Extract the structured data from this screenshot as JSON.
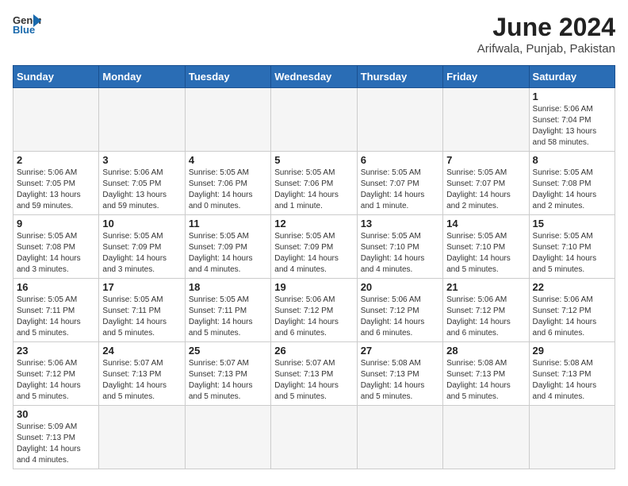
{
  "header": {
    "logo_general": "General",
    "logo_blue": "Blue",
    "month_year": "June 2024",
    "location": "Arifwala, Punjab, Pakistan"
  },
  "weekdays": [
    "Sunday",
    "Monday",
    "Tuesday",
    "Wednesday",
    "Thursday",
    "Friday",
    "Saturday"
  ],
  "days": [
    {
      "num": "",
      "info": ""
    },
    {
      "num": "",
      "info": ""
    },
    {
      "num": "",
      "info": ""
    },
    {
      "num": "",
      "info": ""
    },
    {
      "num": "",
      "info": ""
    },
    {
      "num": "",
      "info": ""
    },
    {
      "num": "1",
      "info": "Sunrise: 5:06 AM\nSunset: 7:04 PM\nDaylight: 13 hours\nand 58 minutes."
    },
    {
      "num": "2",
      "info": "Sunrise: 5:06 AM\nSunset: 7:05 PM\nDaylight: 13 hours\nand 59 minutes."
    },
    {
      "num": "3",
      "info": "Sunrise: 5:06 AM\nSunset: 7:05 PM\nDaylight: 13 hours\nand 59 minutes."
    },
    {
      "num": "4",
      "info": "Sunrise: 5:05 AM\nSunset: 7:06 PM\nDaylight: 14 hours\nand 0 minutes."
    },
    {
      "num": "5",
      "info": "Sunrise: 5:05 AM\nSunset: 7:06 PM\nDaylight: 14 hours\nand 1 minute."
    },
    {
      "num": "6",
      "info": "Sunrise: 5:05 AM\nSunset: 7:07 PM\nDaylight: 14 hours\nand 1 minute."
    },
    {
      "num": "7",
      "info": "Sunrise: 5:05 AM\nSunset: 7:07 PM\nDaylight: 14 hours\nand 2 minutes."
    },
    {
      "num": "8",
      "info": "Sunrise: 5:05 AM\nSunset: 7:08 PM\nDaylight: 14 hours\nand 2 minutes."
    },
    {
      "num": "9",
      "info": "Sunrise: 5:05 AM\nSunset: 7:08 PM\nDaylight: 14 hours\nand 3 minutes."
    },
    {
      "num": "10",
      "info": "Sunrise: 5:05 AM\nSunset: 7:09 PM\nDaylight: 14 hours\nand 3 minutes."
    },
    {
      "num": "11",
      "info": "Sunrise: 5:05 AM\nSunset: 7:09 PM\nDaylight: 14 hours\nand 4 minutes."
    },
    {
      "num": "12",
      "info": "Sunrise: 5:05 AM\nSunset: 7:09 PM\nDaylight: 14 hours\nand 4 minutes."
    },
    {
      "num": "13",
      "info": "Sunrise: 5:05 AM\nSunset: 7:10 PM\nDaylight: 14 hours\nand 4 minutes."
    },
    {
      "num": "14",
      "info": "Sunrise: 5:05 AM\nSunset: 7:10 PM\nDaylight: 14 hours\nand 5 minutes."
    },
    {
      "num": "15",
      "info": "Sunrise: 5:05 AM\nSunset: 7:10 PM\nDaylight: 14 hours\nand 5 minutes."
    },
    {
      "num": "16",
      "info": "Sunrise: 5:05 AM\nSunset: 7:11 PM\nDaylight: 14 hours\nand 5 minutes."
    },
    {
      "num": "17",
      "info": "Sunrise: 5:05 AM\nSunset: 7:11 PM\nDaylight: 14 hours\nand 5 minutes."
    },
    {
      "num": "18",
      "info": "Sunrise: 5:05 AM\nSunset: 7:11 PM\nDaylight: 14 hours\nand 5 minutes."
    },
    {
      "num": "19",
      "info": "Sunrise: 5:06 AM\nSunset: 7:12 PM\nDaylight: 14 hours\nand 6 minutes."
    },
    {
      "num": "20",
      "info": "Sunrise: 5:06 AM\nSunset: 7:12 PM\nDaylight: 14 hours\nand 6 minutes."
    },
    {
      "num": "21",
      "info": "Sunrise: 5:06 AM\nSunset: 7:12 PM\nDaylight: 14 hours\nand 6 minutes."
    },
    {
      "num": "22",
      "info": "Sunrise: 5:06 AM\nSunset: 7:12 PM\nDaylight: 14 hours\nand 6 minutes."
    },
    {
      "num": "23",
      "info": "Sunrise: 5:06 AM\nSunset: 7:12 PM\nDaylight: 14 hours\nand 5 minutes."
    },
    {
      "num": "24",
      "info": "Sunrise: 5:07 AM\nSunset: 7:13 PM\nDaylight: 14 hours\nand 5 minutes."
    },
    {
      "num": "25",
      "info": "Sunrise: 5:07 AM\nSunset: 7:13 PM\nDaylight: 14 hours\nand 5 minutes."
    },
    {
      "num": "26",
      "info": "Sunrise: 5:07 AM\nSunset: 7:13 PM\nDaylight: 14 hours\nand 5 minutes."
    },
    {
      "num": "27",
      "info": "Sunrise: 5:08 AM\nSunset: 7:13 PM\nDaylight: 14 hours\nand 5 minutes."
    },
    {
      "num": "28",
      "info": "Sunrise: 5:08 AM\nSunset: 7:13 PM\nDaylight: 14 hours\nand 5 minutes."
    },
    {
      "num": "29",
      "info": "Sunrise: 5:08 AM\nSunset: 7:13 PM\nDaylight: 14 hours\nand 4 minutes."
    },
    {
      "num": "30",
      "info": "Sunrise: 5:09 AM\nSunset: 7:13 PM\nDaylight: 14 hours\nand 4 minutes."
    },
    {
      "num": "",
      "info": ""
    },
    {
      "num": "",
      "info": ""
    },
    {
      "num": "",
      "info": ""
    },
    {
      "num": "",
      "info": ""
    },
    {
      "num": "",
      "info": ""
    },
    {
      "num": "",
      "info": ""
    }
  ]
}
